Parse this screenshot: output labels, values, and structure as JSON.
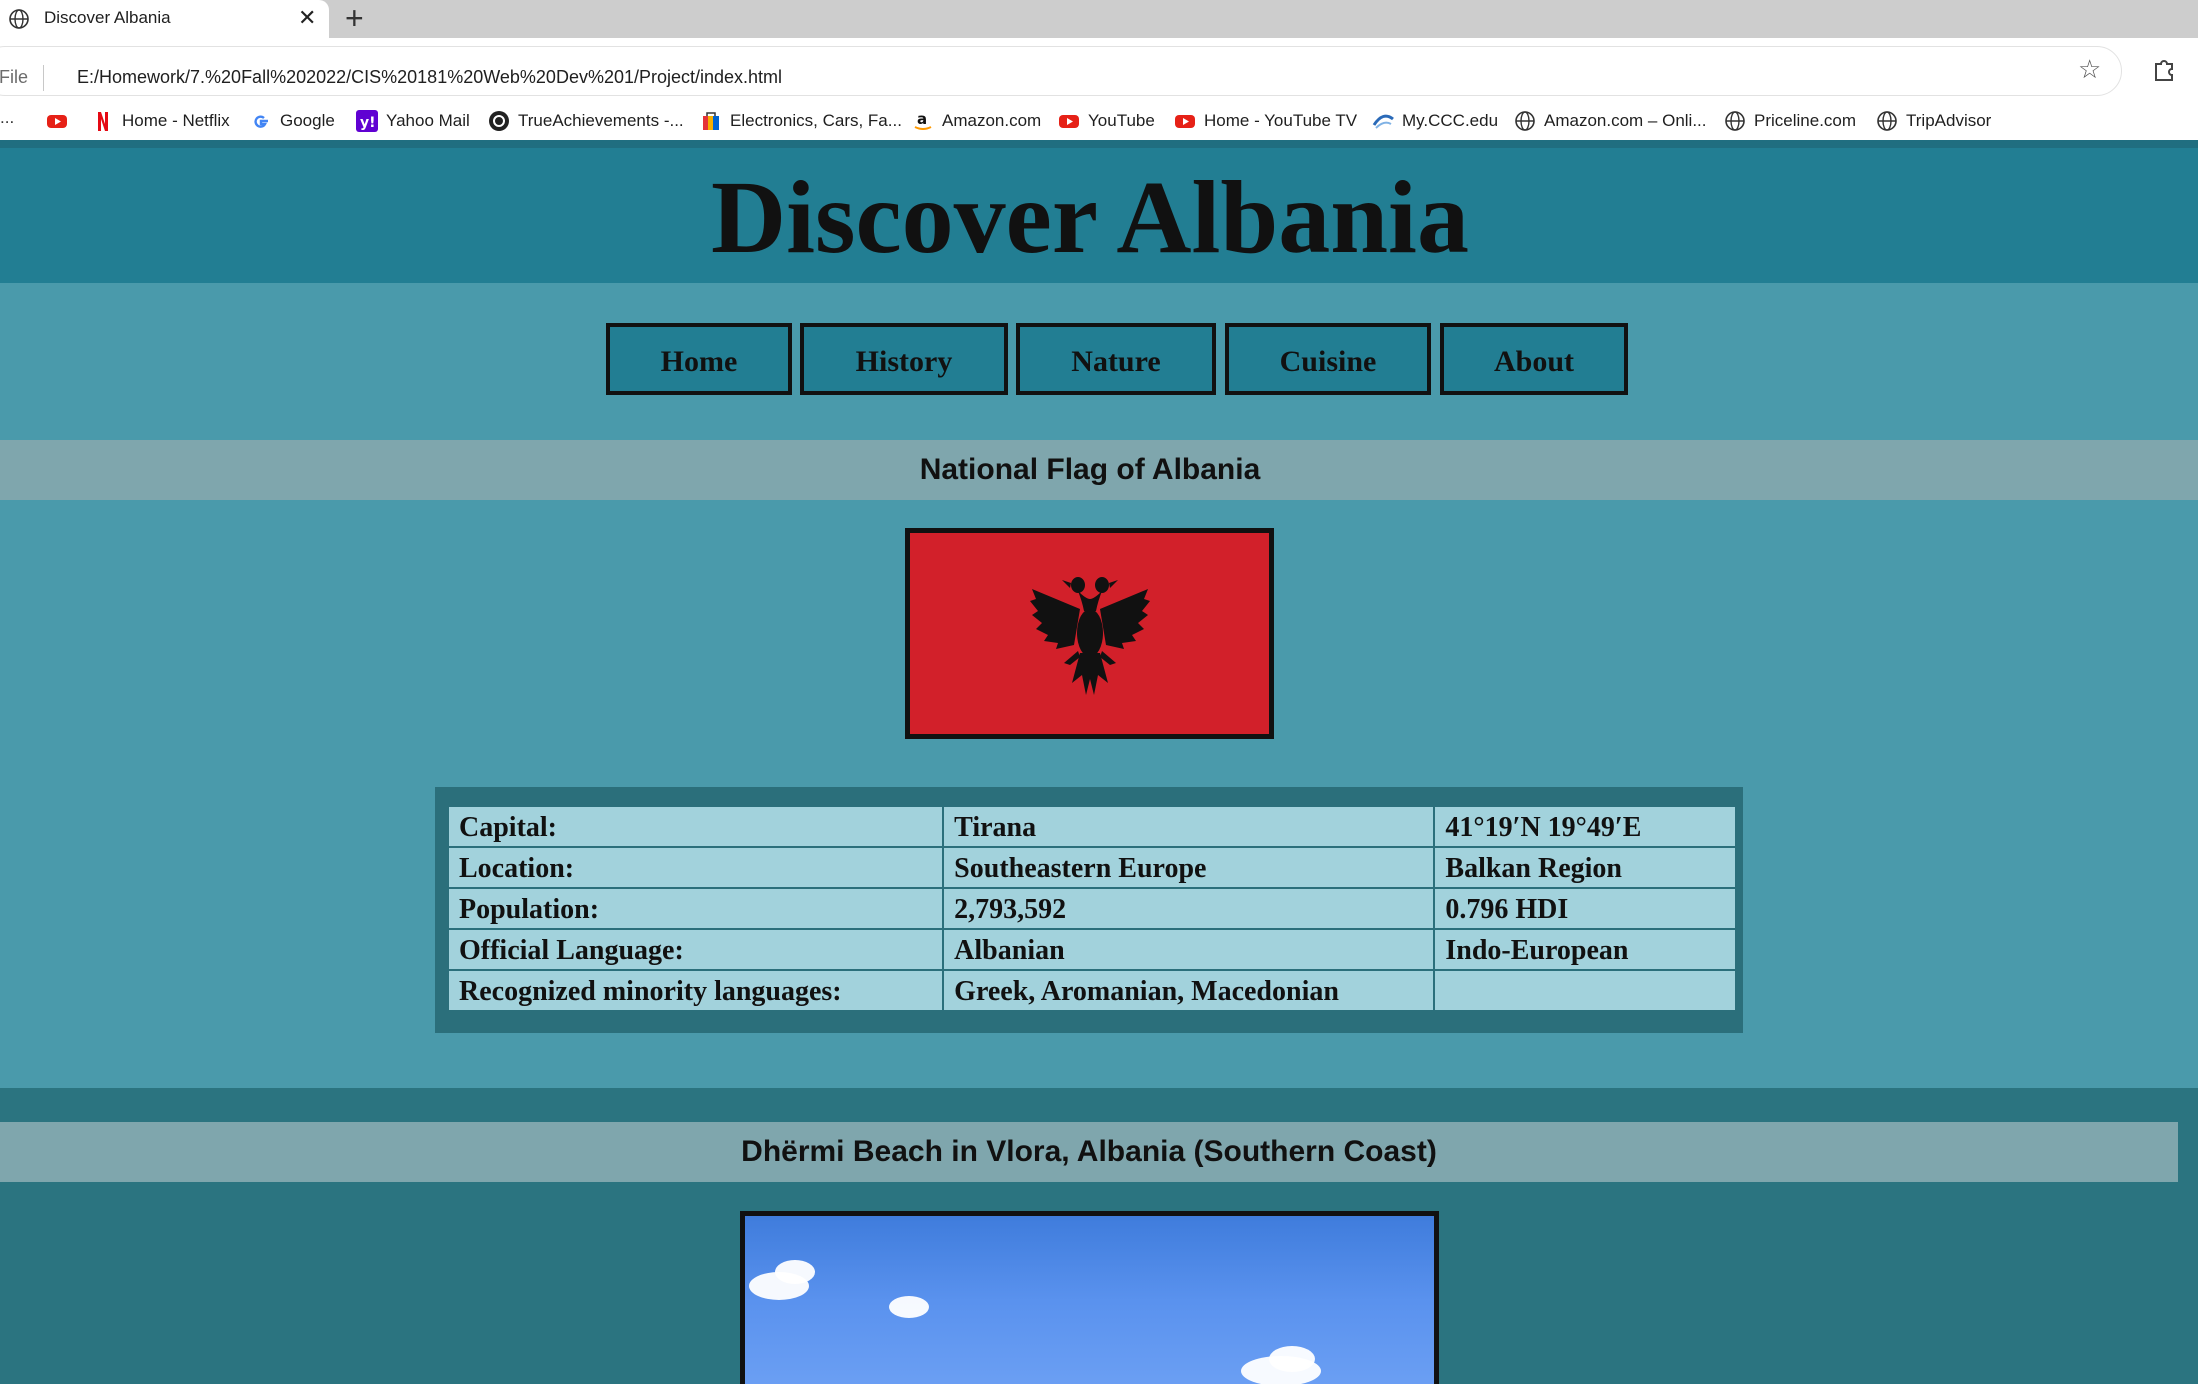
{
  "browser": {
    "tab_title": "Discover Albania",
    "tab_close": "✕",
    "new_tab": "+",
    "file_label": "File",
    "url": "E:/Homework/7.%20Fall%202022/CIS%20181%20Web%20Dev%201/Project/index.html",
    "bookmarks": [
      {
        "label": "",
        "icon": "youtube-icon"
      },
      {
        "label": "Home - Netflix",
        "icon": "netflix-icon"
      },
      {
        "label": "Google",
        "icon": "google-icon"
      },
      {
        "label": "Yahoo Mail",
        "icon": "yahoo-icon"
      },
      {
        "label": "TrueAchievements -...",
        "icon": "trueachievements-icon"
      },
      {
        "label": "Electronics, Cars, Fa...",
        "icon": "ebay-icon"
      },
      {
        "label": "Amazon.com",
        "icon": "amazon-icon"
      },
      {
        "label": "YouTube",
        "icon": "youtube-icon"
      },
      {
        "label": "Home - YouTube TV",
        "icon": "youtube-tv-icon"
      },
      {
        "label": "My.CCC.edu",
        "icon": "ccc-icon"
      },
      {
        "label": "Amazon.com – Onli...",
        "icon": "globe-icon"
      },
      {
        "label": "Priceline.com",
        "icon": "globe-icon"
      },
      {
        "label": "TripAdvisor",
        "icon": "globe-icon"
      }
    ],
    "bookmarks_overflow": "..."
  },
  "site": {
    "title": "Discover Albania",
    "nav": [
      "Home",
      "History",
      "Nature",
      "Cuisine",
      "About"
    ],
    "flag_heading": "National Flag of Albania",
    "facts": [
      [
        "Capital:",
        "Tirana",
        "41°19′N 19°49′E"
      ],
      [
        "Location:",
        "Southeastern Europe",
        "Balkan Region"
      ],
      [
        "Population:",
        "2,793,592",
        "0.796 HDI"
      ],
      [
        "Official Language:",
        "Albanian",
        "Indo-European"
      ],
      [
        "Recognized minority languages:",
        "Greek, Aromanian, Macedonian",
        ""
      ]
    ],
    "beach_heading": "Dhërmi Beach in Vlora, Albania (Southern Coast)"
  },
  "colors": {
    "header": "#227e93",
    "page": "#4a9aab",
    "section_bar": "#7fa6ad",
    "table_cell": "#a2d2dc",
    "table_frame": "#2b6f7b",
    "flag_red": "#d2202a"
  }
}
